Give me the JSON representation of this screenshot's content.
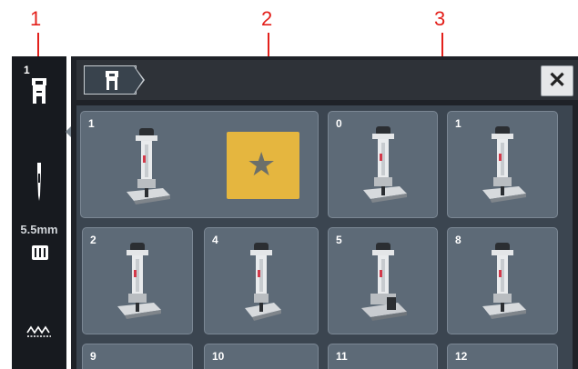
{
  "callouts": [
    "1",
    "2",
    "3"
  ],
  "sidebar": {
    "foot_number": "1",
    "needle_size": "5.5mm",
    "icons": [
      "presser-foot-icon",
      "needle-icon",
      "stitch-plate-icon",
      "zigzag-icon"
    ]
  },
  "header": {
    "tab_icon": "presser-foot-icon",
    "close_label": "✕"
  },
  "favorite": {
    "icon": "star-icon"
  },
  "tiles": [
    {
      "number": "1"
    },
    {
      "number": "0"
    },
    {
      "number": "1"
    },
    {
      "number": "2"
    },
    {
      "number": "4"
    },
    {
      "number": "5"
    },
    {
      "number": "8"
    },
    {
      "number": "9"
    },
    {
      "number": "10"
    },
    {
      "number": "11"
    },
    {
      "number": "12"
    }
  ],
  "colors": {
    "callout": "#e3201b",
    "favorite_bg": "#e5b63f",
    "tile_bg": "#5d6a77",
    "panel_bg": "#1f2228"
  }
}
